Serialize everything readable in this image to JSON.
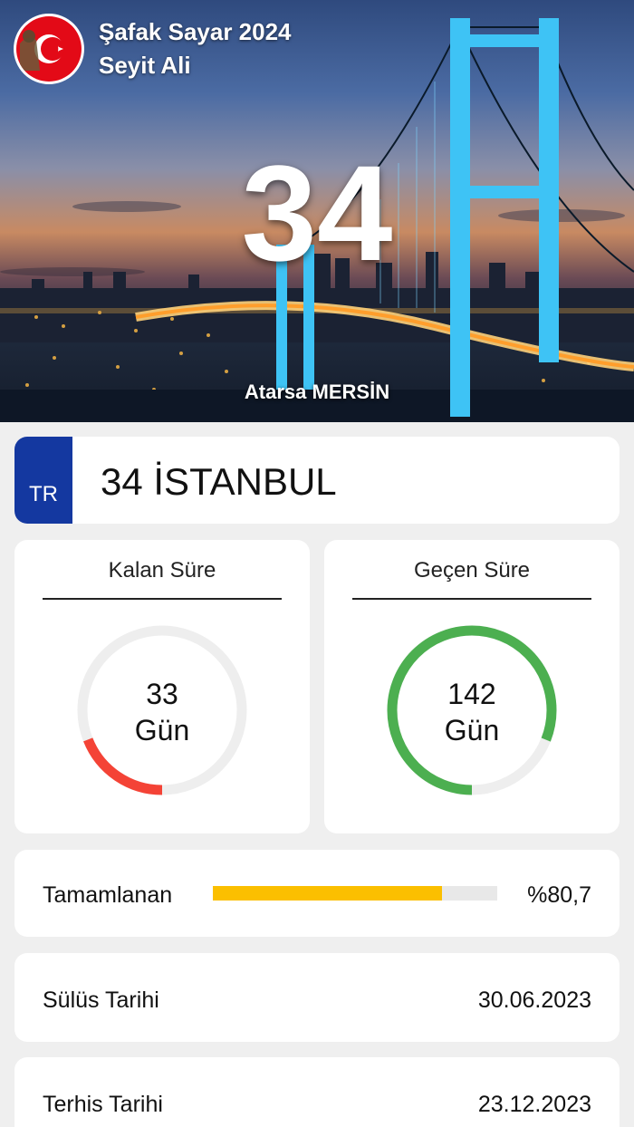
{
  "header": {
    "app_title": "Şafak Sayar 2024",
    "user_name": "Seyit Ali",
    "big_number": "34",
    "location": "Atarsa MERSİN"
  },
  "plate": {
    "country_code": "TR",
    "text": "34 İSTANBUL"
  },
  "remaining": {
    "title": "Kalan Süre",
    "value": "33",
    "unit": "Gün",
    "fraction": 0.19,
    "color": "#f44336"
  },
  "elapsed": {
    "title": "Geçen Süre",
    "value": "142",
    "unit": "Gün",
    "fraction": 0.81,
    "color": "#4caf50"
  },
  "progress": {
    "label": "Tamamlanan",
    "percent_text": "%80,7",
    "fraction": 0.807,
    "color": "#fbbf00"
  },
  "dates": {
    "start_label": "Sülüs Tarihi",
    "start_value": "30.06.2023",
    "end_label": "Terhis Tarihi",
    "end_value": "23.12.2023"
  },
  "colors": {
    "plate_blue": "#1438a0",
    "track_gray": "#eeeeee",
    "flag_red": "#e30a17"
  }
}
